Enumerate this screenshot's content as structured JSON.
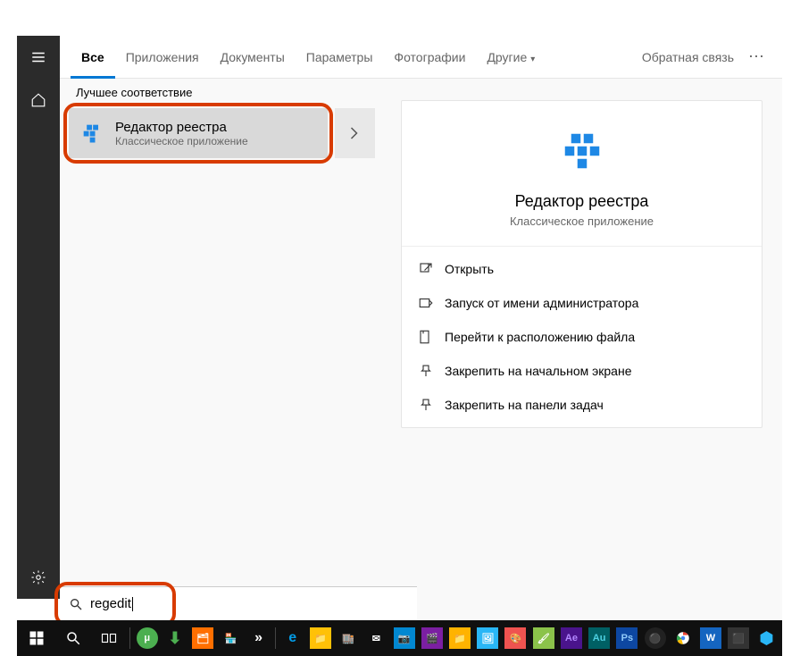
{
  "tabs": {
    "all": "Все",
    "apps": "Приложения",
    "documents": "Документы",
    "settings": "Параметры",
    "photos": "Фотографии",
    "more": "Другие"
  },
  "feedback": "Обратная связь",
  "section_best_match": "Лучшее соответствие",
  "result": {
    "title": "Редактор реестра",
    "subtitle": "Классическое приложение"
  },
  "detail": {
    "title": "Редактор реестра",
    "subtitle": "Классическое приложение",
    "actions": {
      "open": "Открыть",
      "run_admin": "Запуск от имени администратора",
      "file_location": "Перейти к расположению файла",
      "pin_start": "Закрепить на начальном экране",
      "pin_taskbar": "Закрепить на панели задач"
    }
  },
  "search": {
    "value": "regedit"
  }
}
